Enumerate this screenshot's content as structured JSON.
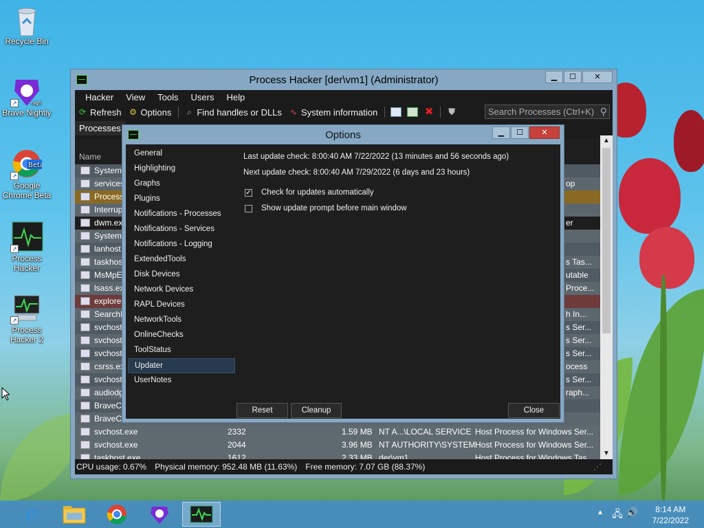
{
  "desktop": {
    "icons": [
      {
        "label": "Recycle Bin"
      },
      {
        "label": "Brave Nightly",
        "badge": "nightly"
      },
      {
        "label": "Google Chrome Beta",
        "badge": "Beta"
      },
      {
        "label": "Process Hacker"
      },
      {
        "label": "Process Hacker 2"
      }
    ]
  },
  "main_window": {
    "title": "Process Hacker [der\\vm1] (Administrator)",
    "menu": [
      "Hacker",
      "View",
      "Tools",
      "Users",
      "Help"
    ],
    "toolbar": {
      "refresh": "Refresh",
      "options": "Options",
      "find_handles": "Find handles or DLLs",
      "system_info": "System information"
    },
    "search_placeholder": "Search Processes (Ctrl+K)",
    "tab": "Processes",
    "column_name": "Name",
    "processes": [
      {
        "name": "System",
        "right": ""
      },
      {
        "name": "services",
        "right": "op"
      },
      {
        "name": "ProcessH",
        "right": ""
      },
      {
        "name": "Interrup",
        "right": ""
      },
      {
        "name": "dwm.exe",
        "right": "er"
      },
      {
        "name": "System",
        "right": ""
      },
      {
        "name": "lanhost.",
        "right": ""
      },
      {
        "name": "taskhost",
        "right": "s Tas..."
      },
      {
        "name": "MsMpEn",
        "right": "utable"
      },
      {
        "name": "lsass.exe",
        "right": "Proce..."
      },
      {
        "name": "explorer",
        "right": ""
      },
      {
        "name": "SearchIn",
        "right": "h In..."
      },
      {
        "name": "svchost.",
        "right": "s Ser..."
      },
      {
        "name": "svchost.",
        "right": "s Ser..."
      },
      {
        "name": "svchost.",
        "right": "s Ser..."
      },
      {
        "name": "csrss.exe",
        "right": "ocess"
      },
      {
        "name": "svchost.",
        "right": "s Ser..."
      },
      {
        "name": "audiodg",
        "right": "raph..."
      },
      {
        "name": "BraveCr",
        "right": ""
      },
      {
        "name": "BraveCr",
        "right": ""
      },
      {
        "name": "svchost.exe",
        "pid": "2332",
        "mem": "1.59 MB",
        "user": "NT A...\\LOCAL SERVICE",
        "desc": "Host Process for Windows Ser..."
      },
      {
        "name": "svchost.exe",
        "pid": "2044",
        "mem": "3.96 MB",
        "user": "NT AUTHORITY\\SYSTEM",
        "desc": "Host Process for Windows Ser..."
      },
      {
        "name": "taskhost.exe",
        "pid": "1612",
        "mem": "2.33 MB",
        "user": "der\\vm1",
        "desc": "Host Process for Windows Tas..."
      }
    ],
    "status": {
      "cpu": "CPU usage: 0.67%",
      "physical": "Physical memory: 952.48 MB (11.63%)",
      "free": "Free memory: 7.07 GB (88.37%)"
    }
  },
  "options_dialog": {
    "title": "Options",
    "categories": [
      "General",
      "Highlighting",
      "Graphs",
      "Plugins",
      "Notifications - Processes",
      "Notifications - Services",
      "Notifications - Logging",
      "ExtendedTools",
      "Disk Devices",
      "Network Devices",
      "RAPL Devices",
      "NetworkTools",
      "OnlineChecks",
      "ToolStatus",
      "Updater",
      "UserNotes"
    ],
    "selected_category": "Updater",
    "last_check": "Last update check: 8:00:40 AM 7/22/2022 (13 minutes and 56 seconds ago)",
    "next_check": "Next update check: 8:00:40 AM 7/29/2022 (6 days and 23 hours)",
    "auto_check_label": "Check for updates automatically",
    "auto_check": true,
    "prompt_label": "Show update prompt before main window",
    "prompt": false,
    "reset": "Reset",
    "cleanup": "Cleanup",
    "close": "Close"
  },
  "taskbar": {
    "time": "8:14 AM",
    "date": "7/22/2022"
  }
}
